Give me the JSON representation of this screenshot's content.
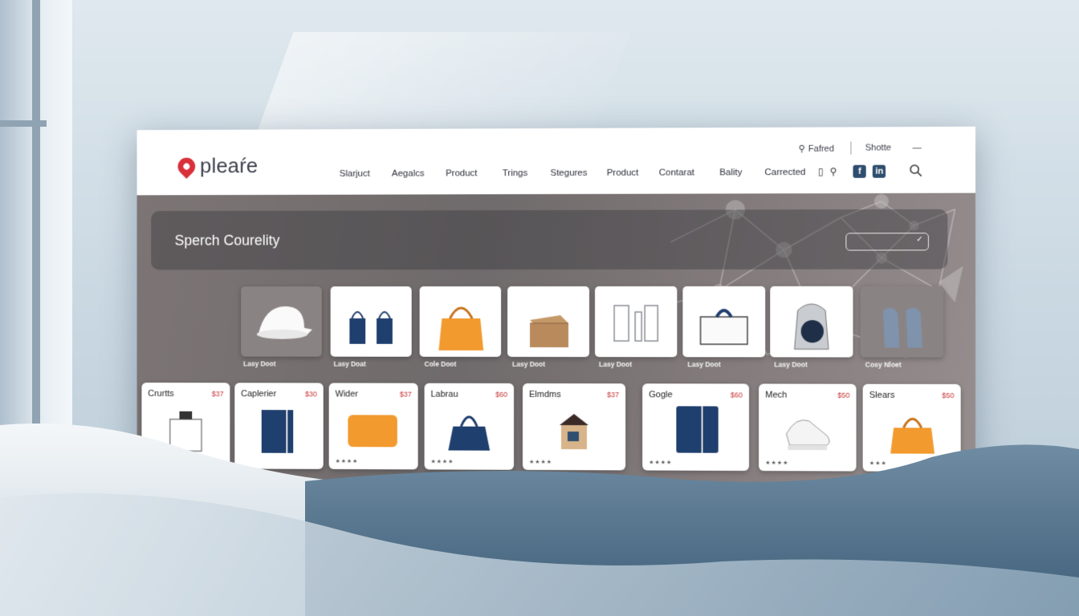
{
  "header": {
    "logo_text": "pleaŕe",
    "util_left": "Fafred",
    "util_right": "Shotte",
    "util_dash": "—",
    "nav": [
      "Slarjuct",
      "Aegalcs",
      "Product",
      "Trings",
      "Stegures",
      "Product",
      "Contarat",
      "Bality",
      "Carrected"
    ]
  },
  "search": {
    "title": "Sperch Courelity",
    "select_value": ""
  },
  "row1": [
    {
      "caption": "Lasy Doot",
      "style": "dim",
      "icon": "cap-icon"
    },
    {
      "caption": "Lasy Doat",
      "style": "light",
      "icon": "tote-bags-icon"
    },
    {
      "caption": "Cole Doot",
      "style": "light",
      "icon": "orange-handbag-icon"
    },
    {
      "caption": "Lasy Doot",
      "style": "light",
      "icon": "box-icon"
    },
    {
      "caption": "Lasy Doot",
      "style": "light",
      "icon": "glass-cases-icon"
    },
    {
      "caption": "Lasy Doot",
      "style": "light",
      "icon": "case-icon"
    },
    {
      "caption": "Lasy Doot",
      "style": "light",
      "icon": "backpack-icon"
    },
    {
      "caption": "Cosy Nloet",
      "style": "dim",
      "icon": "bag-pair-icon"
    }
  ],
  "row2": [
    {
      "name": "Crurtts",
      "price": "$37",
      "icon": "glass-box-icon",
      "stars": ""
    },
    {
      "name": "Caplerier",
      "price": "$30",
      "icon": "notebook-icon",
      "stars": ""
    },
    {
      "name": "Wider",
      "price": "$37",
      "icon": "orange-case-icon",
      "stars": "★★★★"
    },
    {
      "name": "Labrau",
      "price": "$60",
      "icon": "navy-tote-icon",
      "stars": "★★★★"
    },
    {
      "name": "Elmdms",
      "price": "$37",
      "icon": "house-box-icon",
      "stars": "★★★★"
    },
    {
      "name": "Gogle",
      "price": "$60",
      "icon": "folder-icon",
      "stars": "★★★★"
    },
    {
      "name": "Mech",
      "price": "$50",
      "icon": "sneaker-icon",
      "stars": "★★★★"
    },
    {
      "name": "Slears",
      "price": "$50",
      "icon": "orange-tote-icon",
      "stars": "★★★"
    }
  ]
}
